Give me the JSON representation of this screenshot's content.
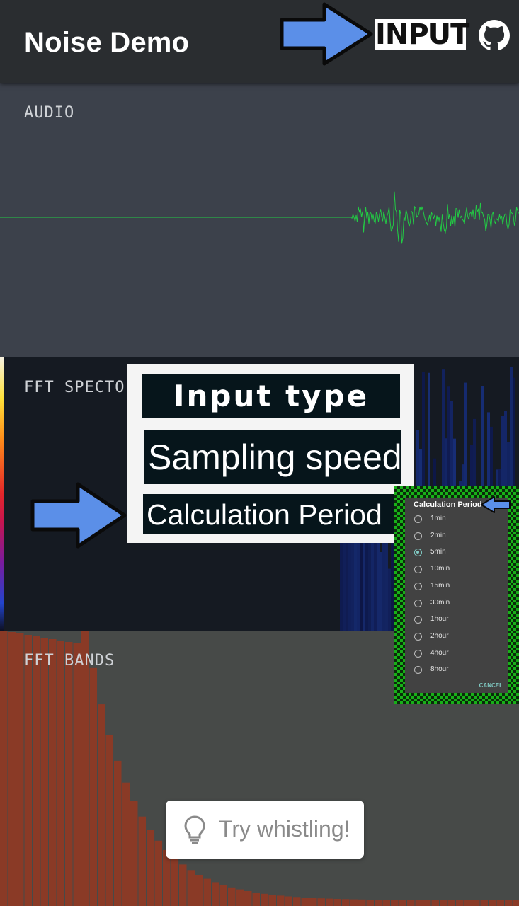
{
  "app_bar": {
    "title": "Noise Demo",
    "input_label": "INPUT",
    "github_icon": "github-icon"
  },
  "sections": {
    "audio_label": "AUDIO",
    "spectrogram_label": "FFT SPECTO",
    "bands_label": "FFT BANDS"
  },
  "menu": {
    "items": [
      "Input type",
      "Sampling speed",
      "Calculation Period"
    ]
  },
  "dialog": {
    "title": "Calculation Period",
    "options": [
      "1min",
      "2min",
      "5min",
      "10min",
      "15min",
      "30min",
      "1hour",
      "2hour",
      "4hour",
      "8hour"
    ],
    "selected": "5min",
    "cancel_label": "CANCEL"
  },
  "toast": {
    "icon": "lightbulb-icon",
    "text": "Try whistling!"
  },
  "colors": {
    "app_bar": "#2a2d30",
    "audio_bg": "#3c414b",
    "waveform": "#22cc44",
    "spectro_bg": "#151a22",
    "bands_bg": "#474a48",
    "band_bar": "#8a3a26",
    "arrow": "#5b8fe8",
    "dialog_accent": "#80cbc4",
    "frame_green": "#18b018"
  }
}
